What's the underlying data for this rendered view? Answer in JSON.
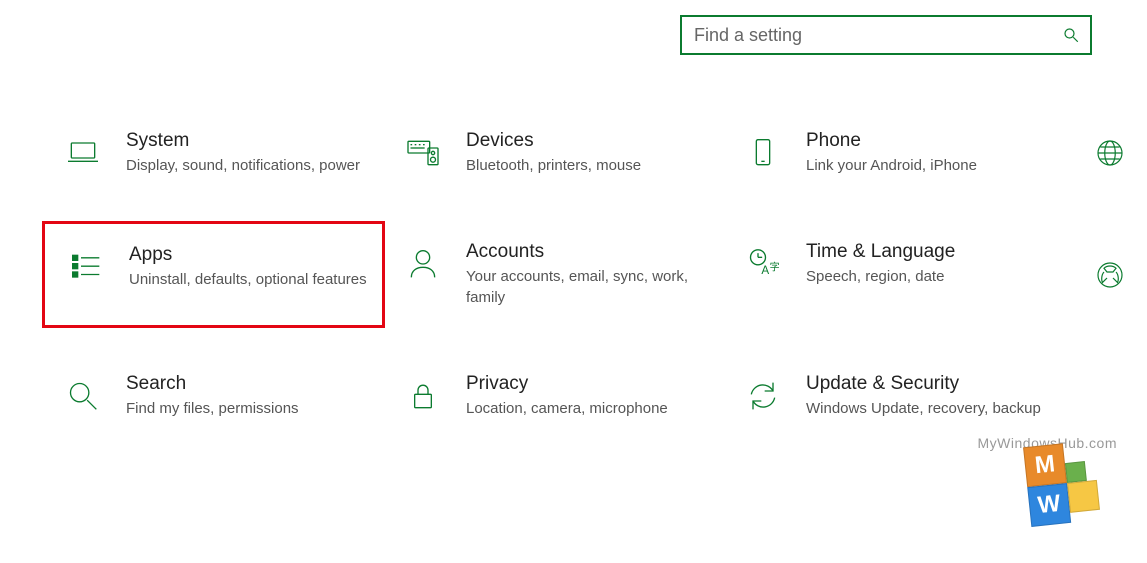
{
  "search": {
    "placeholder": "Find a setting"
  },
  "tiles": {
    "system": {
      "title": "System",
      "desc": "Display, sound, notifications, power"
    },
    "devices": {
      "title": "Devices",
      "desc": "Bluetooth, printers, mouse"
    },
    "phone": {
      "title": "Phone",
      "desc": "Link your Android, iPhone"
    },
    "apps": {
      "title": "Apps",
      "desc": "Uninstall, defaults, optional features"
    },
    "accounts": {
      "title": "Accounts",
      "desc": "Your accounts, email, sync, work, family"
    },
    "time": {
      "title": "Time & Language",
      "desc": "Speech, region, date"
    },
    "search": {
      "title": "Search",
      "desc": "Find my files, permissions"
    },
    "privacy": {
      "title": "Privacy",
      "desc": "Location, camera, microphone"
    },
    "update": {
      "title": "Update & Security",
      "desc": "Windows Update, recovery, backup"
    }
  },
  "watermark": "MyWindowsHub.com"
}
